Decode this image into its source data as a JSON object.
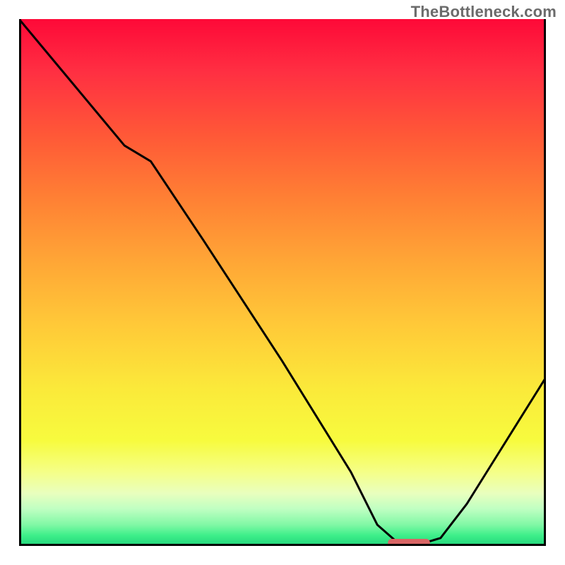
{
  "watermark": "TheBottleneck.com",
  "chart_data": {
    "type": "line",
    "title": "",
    "xlabel": "",
    "ylabel": "",
    "xlim": [
      0,
      100
    ],
    "ylim": [
      0,
      100
    ],
    "series": [
      {
        "name": "bottleneck-curve",
        "x": [
          0,
          10,
          20,
          25,
          35,
          50,
          63,
          68,
          72,
          76,
          80,
          85,
          90,
          95,
          100
        ],
        "y": [
          100,
          88,
          76,
          73,
          58,
          35,
          14,
          4,
          0.5,
          0.3,
          1.5,
          8,
          16,
          24,
          32
        ]
      }
    ],
    "marker": {
      "name": "optimal-range",
      "shape": "capsule",
      "x_start": 70,
      "x_end": 78,
      "y": 0.6,
      "color": "#d96565"
    },
    "background_gradient": {
      "stops": [
        {
          "pos": 0.0,
          "color": "#fe0938"
        },
        {
          "pos": 0.5,
          "color": "#ffb636"
        },
        {
          "pos": 0.8,
          "color": "#f7fb3e"
        },
        {
          "pos": 1.0,
          "color": "#21d57a"
        }
      ],
      "direction": "top-to-bottom"
    }
  }
}
